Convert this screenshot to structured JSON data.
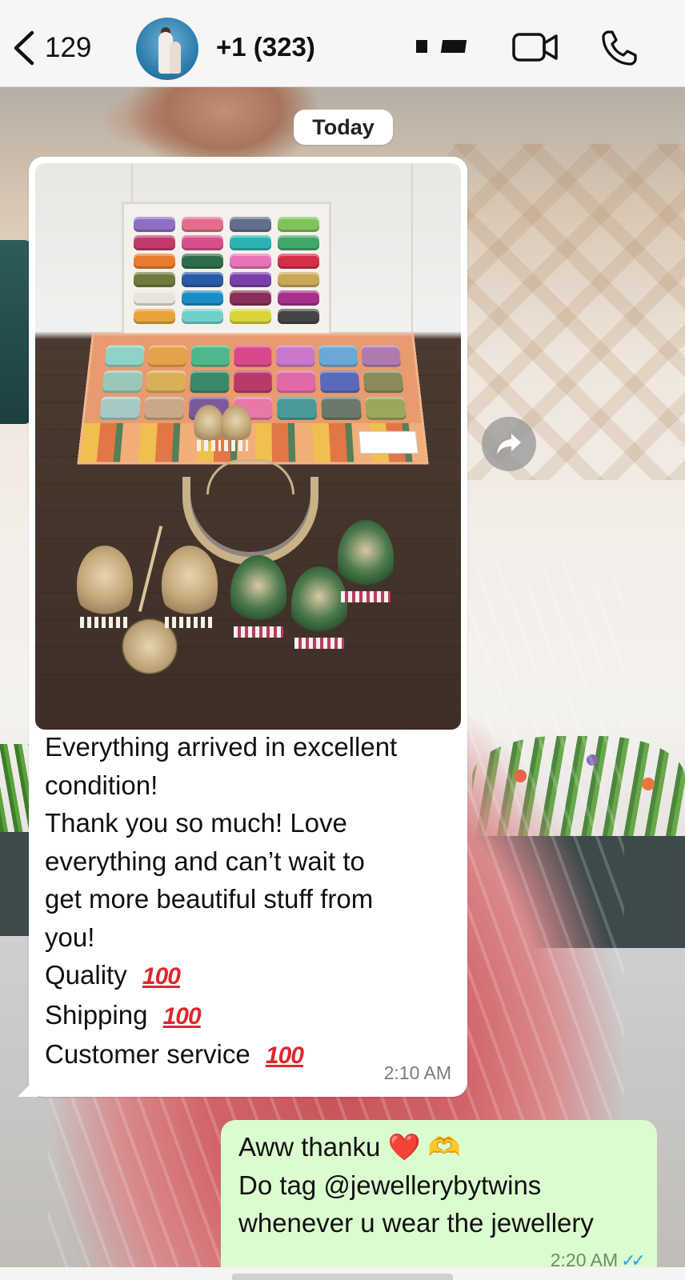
{
  "header": {
    "back_count": "129",
    "contact_name": "+1 (323)",
    "icons": [
      "chevron-left-icon",
      "video-camera-icon",
      "phone-icon"
    ]
  },
  "chat": {
    "date_divider": "Today",
    "messages": [
      {
        "direction": "incoming",
        "has_photo": true,
        "lines": [
          "Everything arrived in excellent",
          "condition!",
          "Thank you so much! Love",
          "everything and can’t wait to",
          "get more beautiful stuff from",
          "you!"
        ],
        "ratings": [
          {
            "label": "Quality",
            "emoji": "💯"
          },
          {
            "label": "Shipping",
            "emoji": "💯"
          },
          {
            "label": "Customer service",
            "emoji": "💯"
          }
        ],
        "time": "2:10 AM"
      },
      {
        "direction": "outgoing",
        "line1_text": "Aww thanku",
        "line1_emoji_heart": "❤️",
        "line1_emoji_hands": "🫶",
        "lines": [
          "Do tag @jewellerybytwins",
          "whenever u wear the jewellery"
        ],
        "time": "2:20 AM",
        "read_ticks": "✓✓"
      }
    ]
  },
  "colors": {
    "incoming_bubble": "#ffffff",
    "outgoing_bubble": "#dafccf",
    "header_bg": "#f6f6f6",
    "read_tick": "#2e9ef5",
    "hundred_emoji": "#e0262e"
  }
}
